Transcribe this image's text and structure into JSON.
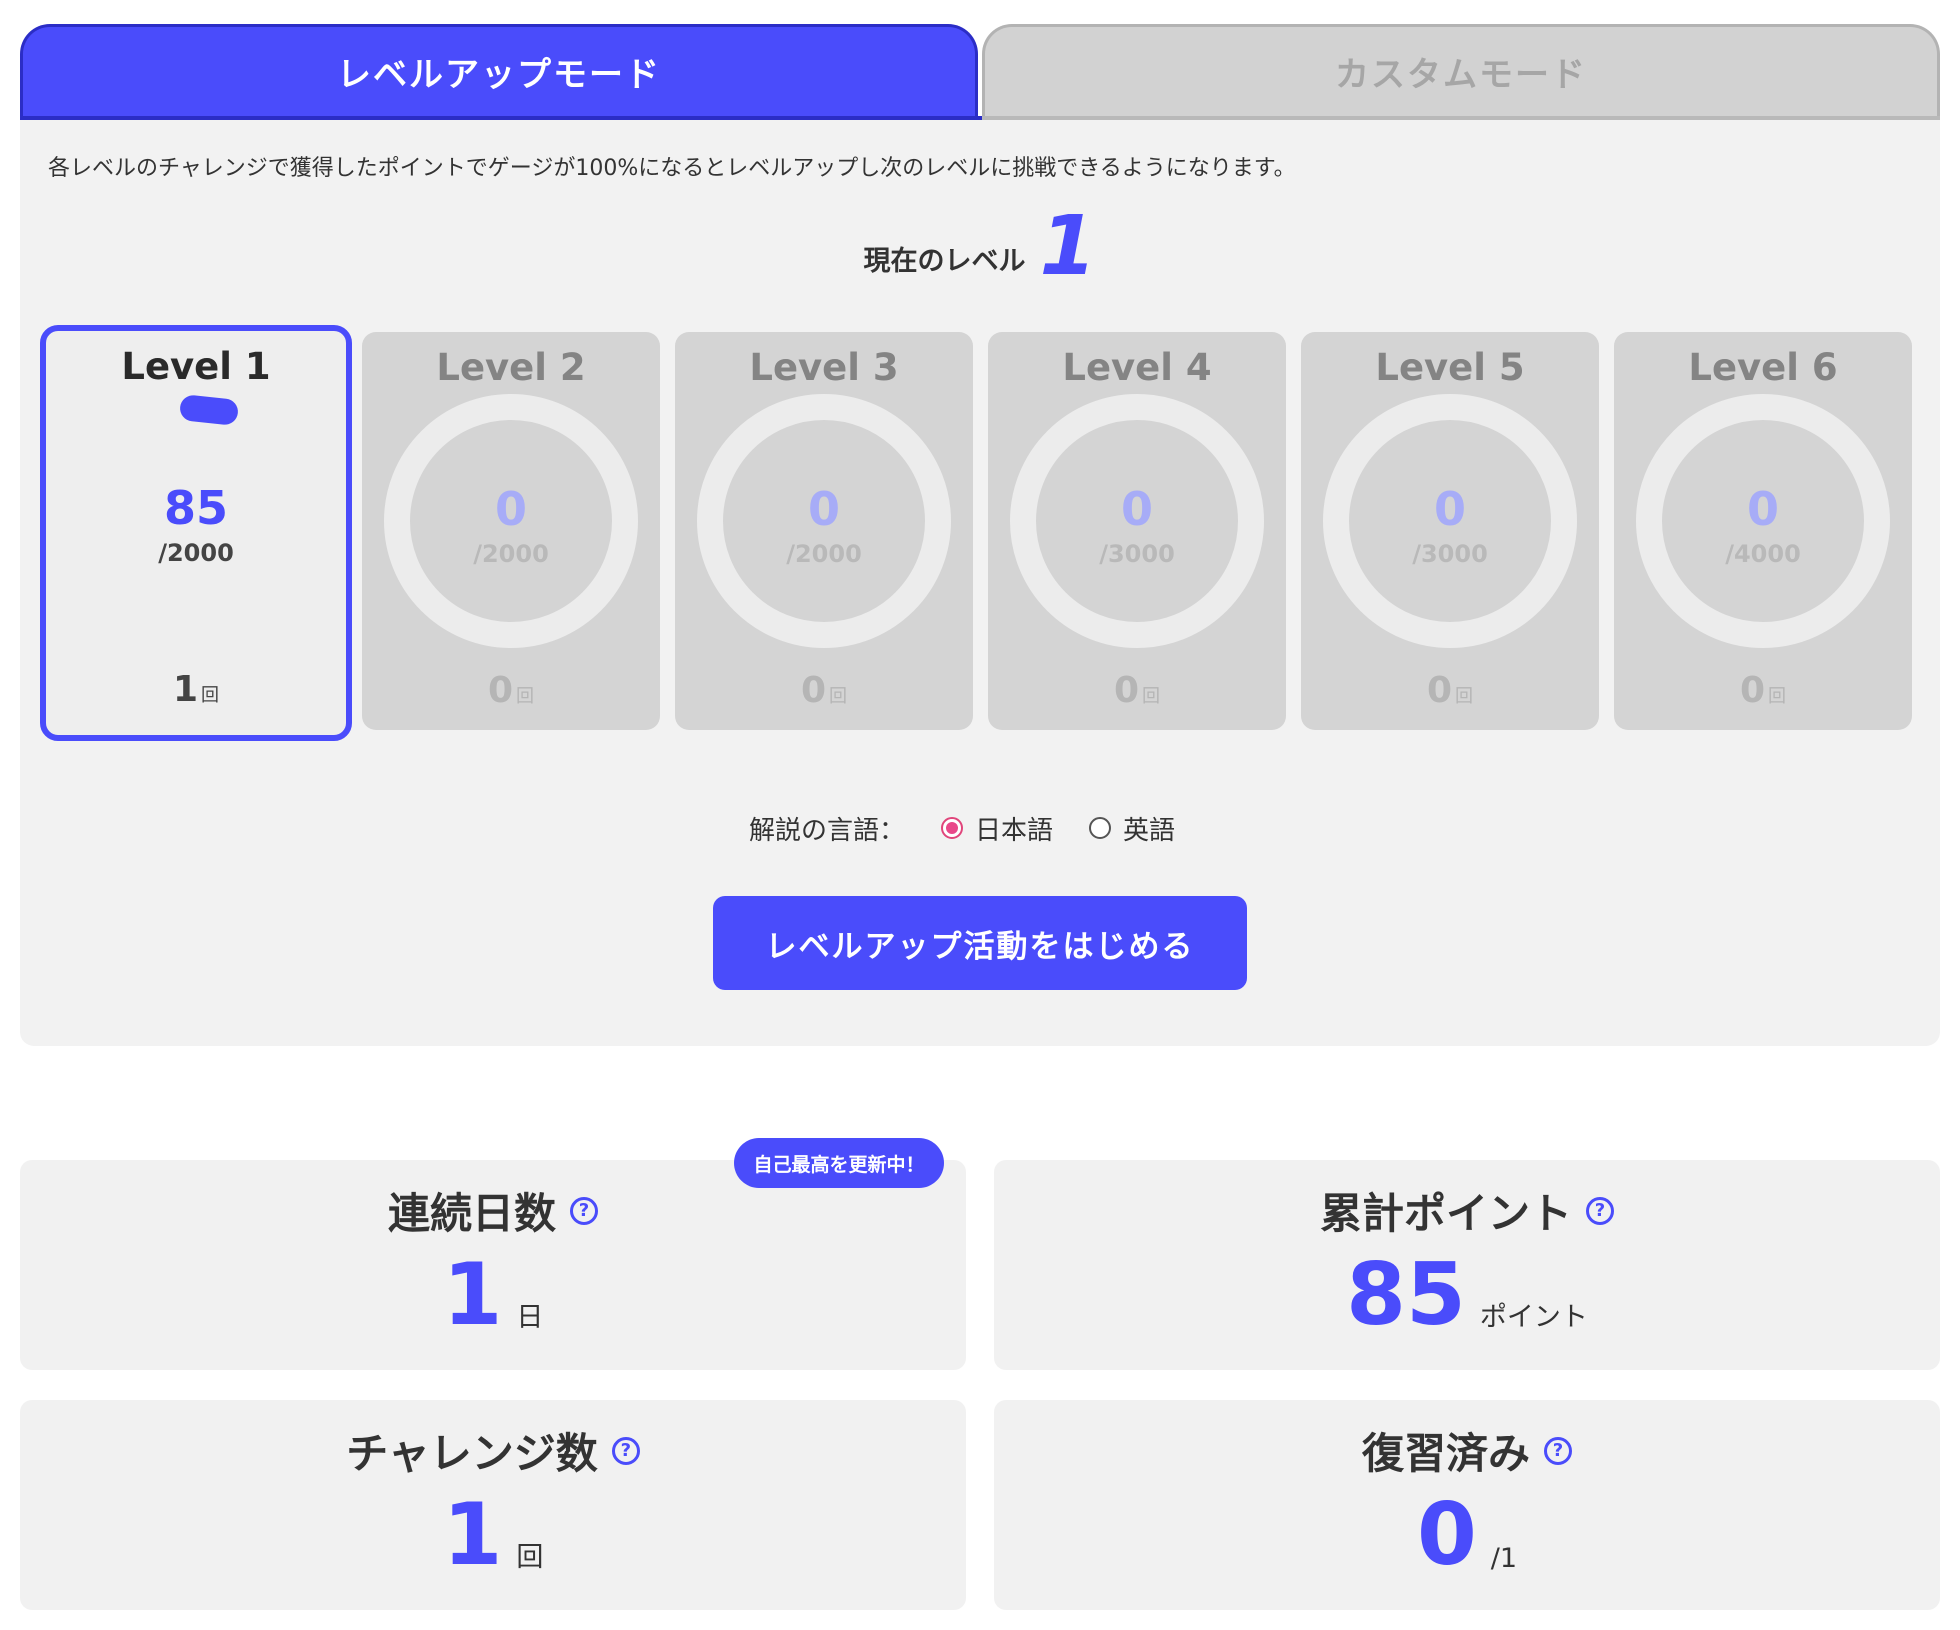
{
  "tabs": {
    "levelup": "レベルアップモード",
    "custom": "カスタムモード"
  },
  "description": "各レベルのチャレンジで獲得したポイントでゲージが100%になるとレベルアップし次のレベルに挑戦できるようになります。",
  "current_level": {
    "label": "現在のレベル",
    "value": "1"
  },
  "levels": [
    {
      "title": "Level 1",
      "points": "85",
      "max": "/2000",
      "count": "1",
      "unit": "回",
      "progress_pct": 4.25
    },
    {
      "title": "Level 2",
      "points": "0",
      "max": "/2000",
      "count": "0",
      "unit": "回",
      "progress_pct": 0
    },
    {
      "title": "Level 3",
      "points": "0",
      "max": "/2000",
      "count": "0",
      "unit": "回",
      "progress_pct": 0
    },
    {
      "title": "Level 4",
      "points": "0",
      "max": "/3000",
      "count": "0",
      "unit": "回",
      "progress_pct": 0
    },
    {
      "title": "Level 5",
      "points": "0",
      "max": "/3000",
      "count": "0",
      "unit": "回",
      "progress_pct": 0
    },
    {
      "title": "Level 6",
      "points": "0",
      "max": "/4000",
      "count": "0",
      "unit": "回",
      "progress_pct": 0
    }
  ],
  "language": {
    "label": "解説の言語：",
    "options": [
      "日本語",
      "英語"
    ],
    "selected": "日本語"
  },
  "start_button": "レベルアップ活動をはじめる",
  "badge": "自己最高を更新中！",
  "stats": {
    "streak": {
      "title": "連続日数",
      "value": "1",
      "unit": "日"
    },
    "total_points": {
      "title": "累計ポイント",
      "value": "85",
      "unit": "ポイント"
    },
    "challenges": {
      "title": "チャレンジ数",
      "value": "1",
      "unit": "回"
    },
    "reviewed": {
      "title": "復習済み",
      "value": "0",
      "unit": "/1"
    }
  },
  "help_icon": "?",
  "colors": {
    "accent": "#4a4cfb",
    "radio": "#e9488a",
    "panel": "#f2f2f2"
  }
}
